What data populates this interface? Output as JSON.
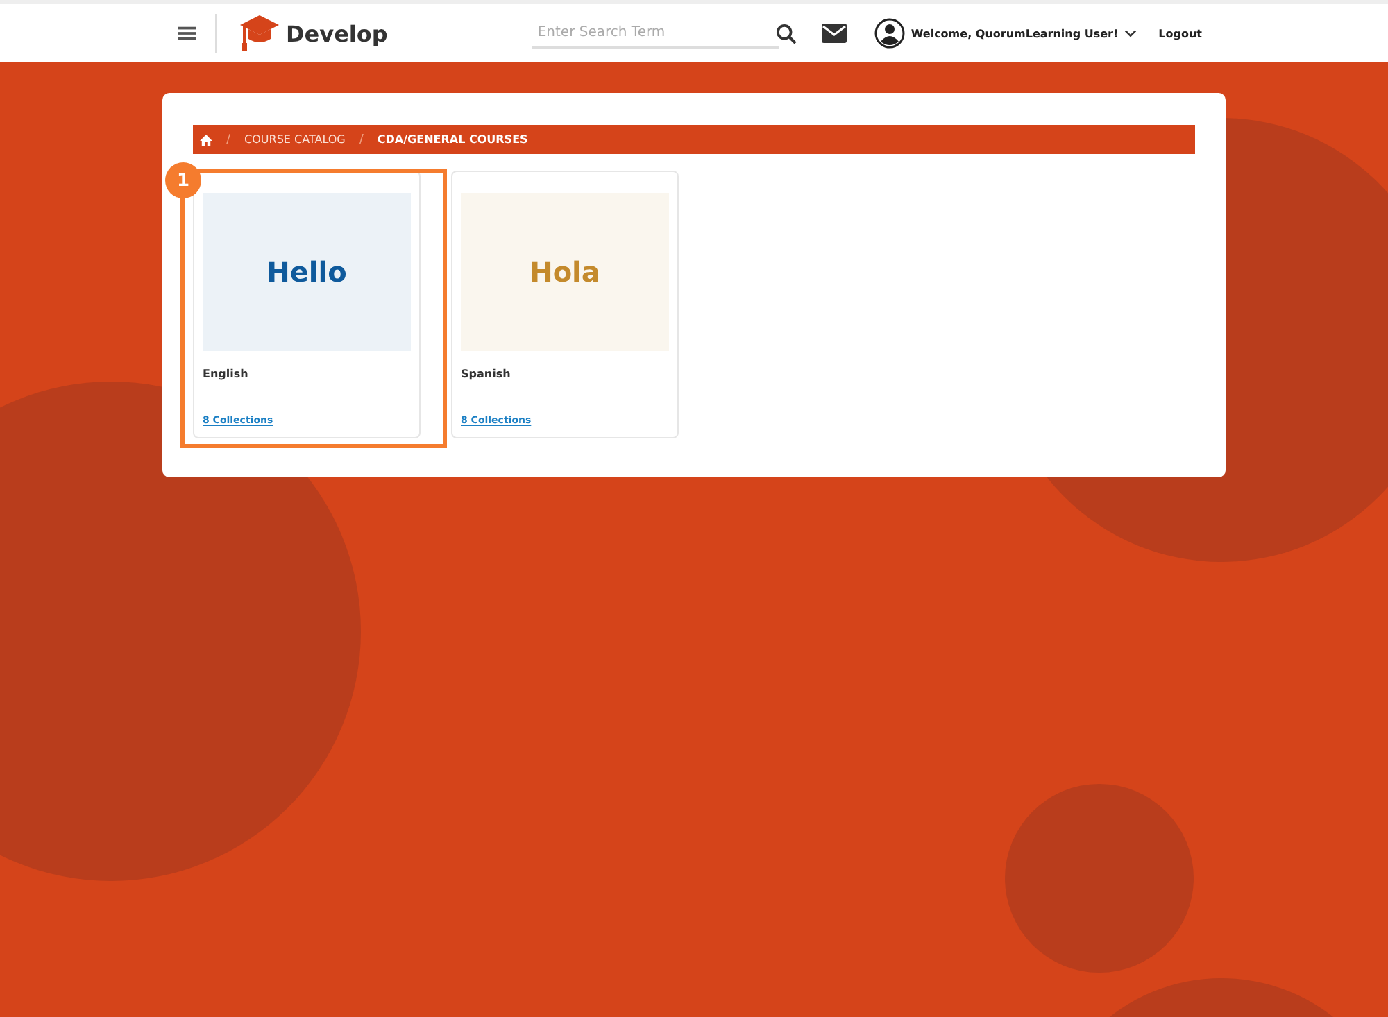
{
  "header": {
    "brand": "Develop",
    "search": {
      "placeholder": "Enter Search Term"
    },
    "welcome": "Welcome, QuorumLearning User!",
    "logout": "Logout"
  },
  "breadcrumb": [
    {
      "separator": "/",
      "label": "COURSE CATALOG",
      "current": false
    },
    {
      "separator": "/",
      "label": "CDA/GENERAL COURSES",
      "current": true
    }
  ],
  "cards": [
    {
      "hero": "Hello",
      "title": "English",
      "link": "8 Collections",
      "color": "#0f5a9c",
      "highlight": "1"
    },
    {
      "hero": "Hola",
      "title": "Spanish",
      "link": "8 Collections",
      "color": "#c48a2c"
    }
  ]
}
